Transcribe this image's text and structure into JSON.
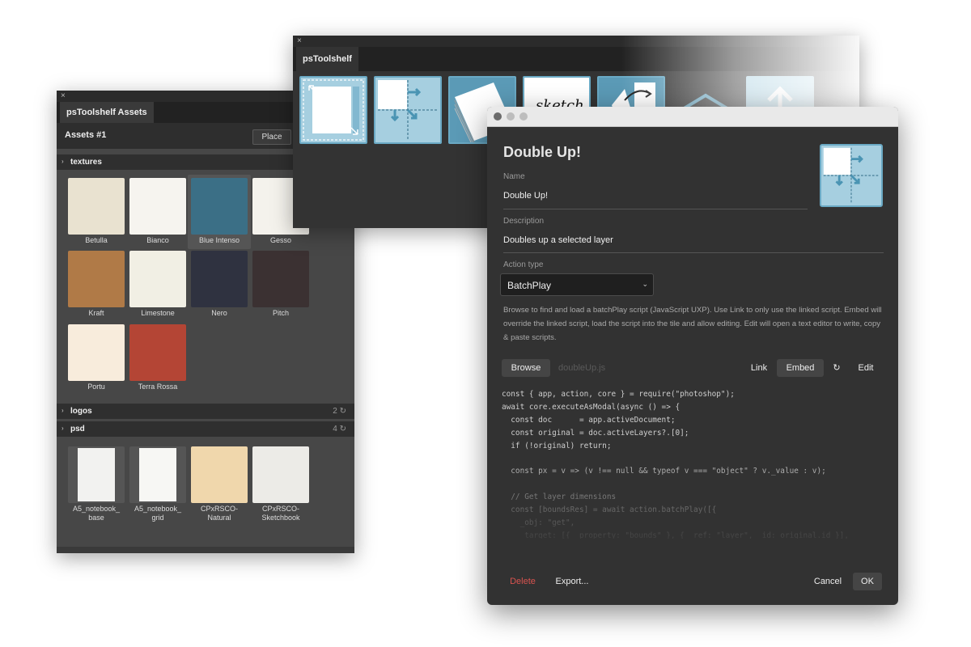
{
  "assets_panel": {
    "close": "×",
    "tab": "psToolshelf Assets",
    "header_title": "Assets #1",
    "place_label": "Place",
    "groups": [
      {
        "label": "textures"
      },
      {
        "label": "logos",
        "count": "2"
      },
      {
        "label": "psd",
        "count": "4"
      }
    ],
    "textures": [
      {
        "name": "Betulla",
        "color": "#e9e2d0"
      },
      {
        "name": "Bianco",
        "color": "#f6f4ef"
      },
      {
        "name": "Blue Intenso",
        "color": "#3b6f86"
      },
      {
        "name": "Gesso",
        "color": "#f4f2ec"
      },
      {
        "name": "Kraft",
        "color": "#b07a47"
      },
      {
        "name": "Limestone",
        "color": "#f1efe4"
      },
      {
        "name": "Nero",
        "color": "#2f3240"
      },
      {
        "name": "Pitch",
        "color": "#3b3132"
      },
      {
        "name": "Portu",
        "color": "#f8ecdc"
      },
      {
        "name": "Terra Rossa",
        "color": "#b44535"
      }
    ],
    "psd": [
      {
        "line1": "A5_notebook_",
        "line2": "base"
      },
      {
        "line1": "A5_notebook_",
        "line2": "grid"
      },
      {
        "line1": "CPxRSCO-",
        "line2": "Natural"
      },
      {
        "line1": "CPxRSCO-",
        "line2": "Sketchbook"
      }
    ]
  },
  "toolshelf": {
    "close": "×",
    "tab": "psToolshelf",
    "sketch_label": "sketch"
  },
  "dialog": {
    "title": "Double Up!",
    "name_label": "Name",
    "name_value": "Double Up!",
    "description_label": "Description",
    "description_value": "Doubles up a selected layer",
    "action_type_label": "Action type",
    "action_type_value": "BatchPlay",
    "help_text": "Browse to find and load a batchPlay script (JavaScript UXP). Use Link to only use the linked script. Embed will override the linked script, load the script into the tile and allow editing. Edit will open a text editor to write, copy & paste scripts.",
    "browse_label": "Browse",
    "file_name": "doubleUp.js",
    "link_label": "Link",
    "embed_label": "Embed",
    "refresh_glyph": "↻",
    "edit_label": "Edit",
    "code": "const { app, action, core } = require(\"photoshop\");\nawait core.executeAsModal(async () => {\n  const doc      = app.activeDocument;\n  const original = doc.activeLayers?.[0];\n  if (!original) return;\n\n  const px = v => (v !== null && typeof v === \"object\" ? v._value : v);\n\n  // Get layer dimensions\n  const [boundsRes] = await action.batchPlay([{\n    _obj: \"get\",\n    _target: [{ _property: \"bounds\" }, { _ref: \"layer\", _id: original.id }],",
    "delete_label": "Delete",
    "export_label": "Export...",
    "cancel_label": "Cancel",
    "ok_label": "OK"
  },
  "colors": {
    "accent": "#6aa9c4",
    "delete": "#d9534f"
  }
}
